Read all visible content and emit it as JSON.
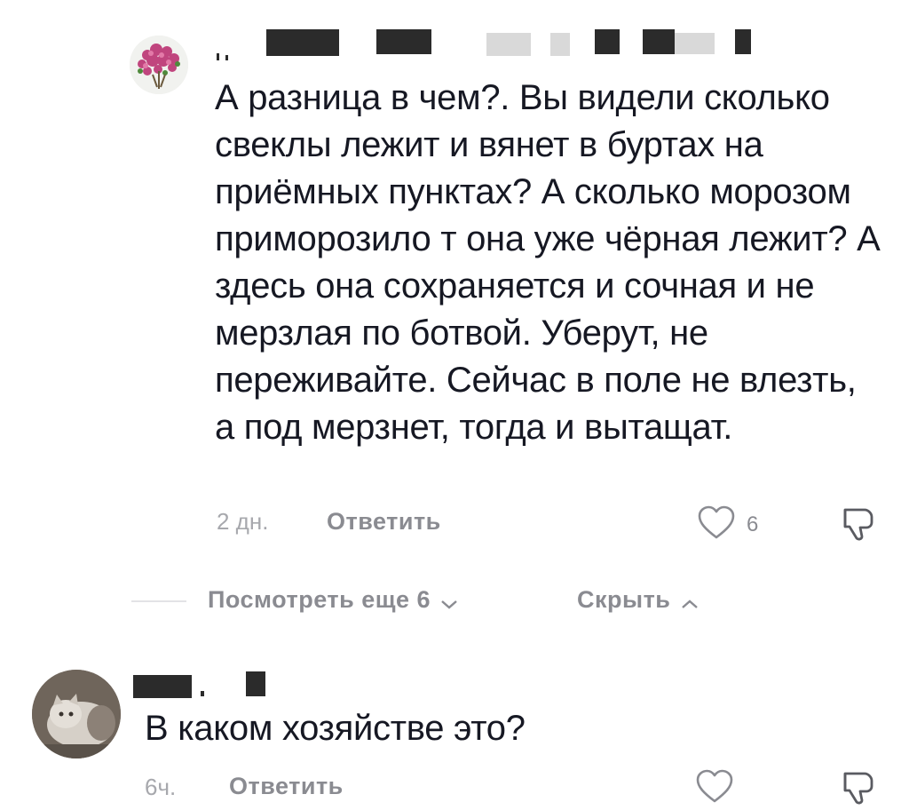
{
  "comments": [
    {
      "text": "А разница в чем?. Вы видели сколько свеклы лежит и вянет в буртах на приёмных пунктах? А сколько морозом приморозило т она уже чёрная лежит? А здесь она сохраняется и сочная и не мерзлая по ботвой. Уберут, не переживайте. Сейчас в поле не влезть, а под мерзнет, тогда и вытащат.",
      "time": "2 дн.",
      "reply_label": "Ответить",
      "likes": "6"
    },
    {
      "text": "В каком хозяйстве это?",
      "time": "6ч.",
      "reply_label": "Ответить",
      "likes": ""
    }
  ],
  "thread_controls": {
    "view_more": "Посмотреть еще 6",
    "hide": "Скрыть"
  },
  "icons": [
    "heart-outline-icon",
    "dislike-icon",
    "chevron-down-icon",
    "chevron-up-icon"
  ]
}
